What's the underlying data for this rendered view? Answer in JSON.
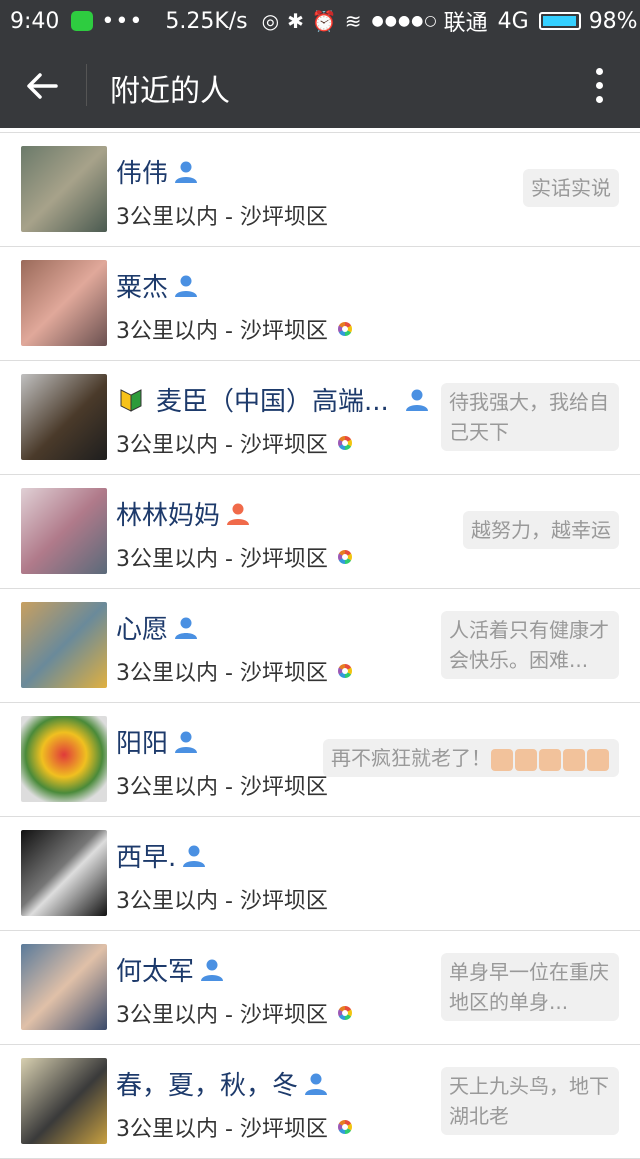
{
  "status_bar": {
    "time": "9:40",
    "dots": "•••",
    "speed": "5.25K/s",
    "signal": "●●●●○",
    "carrier": "联通",
    "network": "4G",
    "battery": "98%"
  },
  "header": {
    "title": "附近的人"
  },
  "people": [
    {
      "name": "伟伟",
      "location": "3公里以内 - 沙坪坝区",
      "signature": "实话实说",
      "gender": "male",
      "moments": false,
      "badge": false
    },
    {
      "name": "粟杰",
      "location": "3公里以内 - 沙坪坝区",
      "signature": "",
      "gender": "male",
      "moments": true,
      "badge": false
    },
    {
      "name": "麦臣（中国）高端...",
      "location": "3公里以内 - 沙坪坝区",
      "signature": "待我强大，我给自己天下",
      "gender": "male",
      "moments": true,
      "badge": true
    },
    {
      "name": "林林妈妈",
      "location": "3公里以内 - 沙坪坝区",
      "signature": "越努力，越幸运",
      "gender": "female",
      "moments": true,
      "badge": false
    },
    {
      "name": "心愿",
      "location": "3公里以内 - 沙坪坝区",
      "signature": "人活着只有健康才会快乐。困难...",
      "gender": "male",
      "moments": true,
      "badge": false
    },
    {
      "name": "阳阳",
      "location": "3公里以内 - 沙坪坝区",
      "signature": "再不疯狂就老了！",
      "gender": "male",
      "moments": false,
      "badge": false,
      "fists": 5
    },
    {
      "name": "西早.",
      "location": "3公里以内 - 沙坪坝区",
      "signature": "",
      "gender": "male",
      "moments": false,
      "badge": false
    },
    {
      "name": "何太军",
      "location": "3公里以内 - 沙坪坝区",
      "signature": "单身早一位在重庆地区的单身...",
      "gender": "male",
      "moments": true,
      "badge": false
    },
    {
      "name": "春，夏，秋，冬",
      "location": "3公里以内 - 沙坪坝区",
      "signature": "天上九头鸟，地下湖北老",
      "gender": "male",
      "moments": true,
      "badge": false
    }
  ],
  "colors": {
    "male": "#4a90e2",
    "female": "#f06a4a",
    "name": "#1d3a6b",
    "bar": "#37393c"
  },
  "icons": {
    "back": "arrow-left-icon",
    "more": "more-vertical-icon",
    "gender": "person-icon",
    "moments": "moments-icon",
    "badge": "beginner-badge-icon"
  }
}
